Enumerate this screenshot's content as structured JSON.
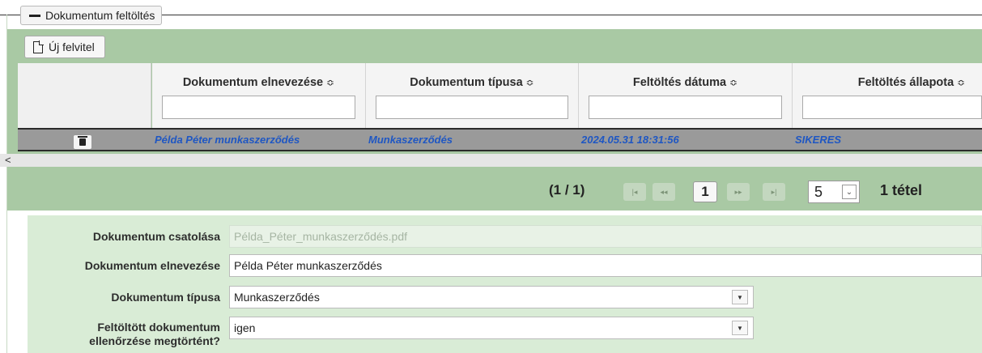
{
  "section": {
    "legend": "Dokumentum feltöltés"
  },
  "toolbar": {
    "new_label": "Új felvitel"
  },
  "table": {
    "columns": [
      {
        "label": "Dokumentum elnevezése",
        "sort": "≎"
      },
      {
        "label": "Dokumentum típusa",
        "sort": "≎"
      },
      {
        "label": "Feltöltés dátuma",
        "sort": "≎"
      },
      {
        "label": "Feltöltés állapota",
        "sort": "≎"
      }
    ],
    "rows": [
      {
        "name": "Példa Péter munkaszerződés",
        "type": "Munkaszerződés",
        "date": "2024.05.31 18:31:56",
        "status": "SIKERES"
      }
    ],
    "scroll_left": "<"
  },
  "paginator": {
    "info": "(1 / 1)",
    "first": "|◂",
    "prev": "◂◂",
    "current": "1",
    "next": "▸▸",
    "last": "▸|",
    "rows_per_page": "5",
    "count": "1 tétel"
  },
  "form": {
    "attach_label": "Dokumentum csatolása",
    "attach_value": "Példa_Péter_munkaszerződés.pdf",
    "name_label": "Dokumentum elnevezése",
    "name_value": "Példa Péter munkaszerződés",
    "type_label": "Dokumentum típusa",
    "type_value": "Munkaszerződés",
    "checked_label_1": "Feltöltött dokumentum",
    "checked_label_2": "ellenőrzése megtörtént?",
    "checked_value": "igen"
  }
}
